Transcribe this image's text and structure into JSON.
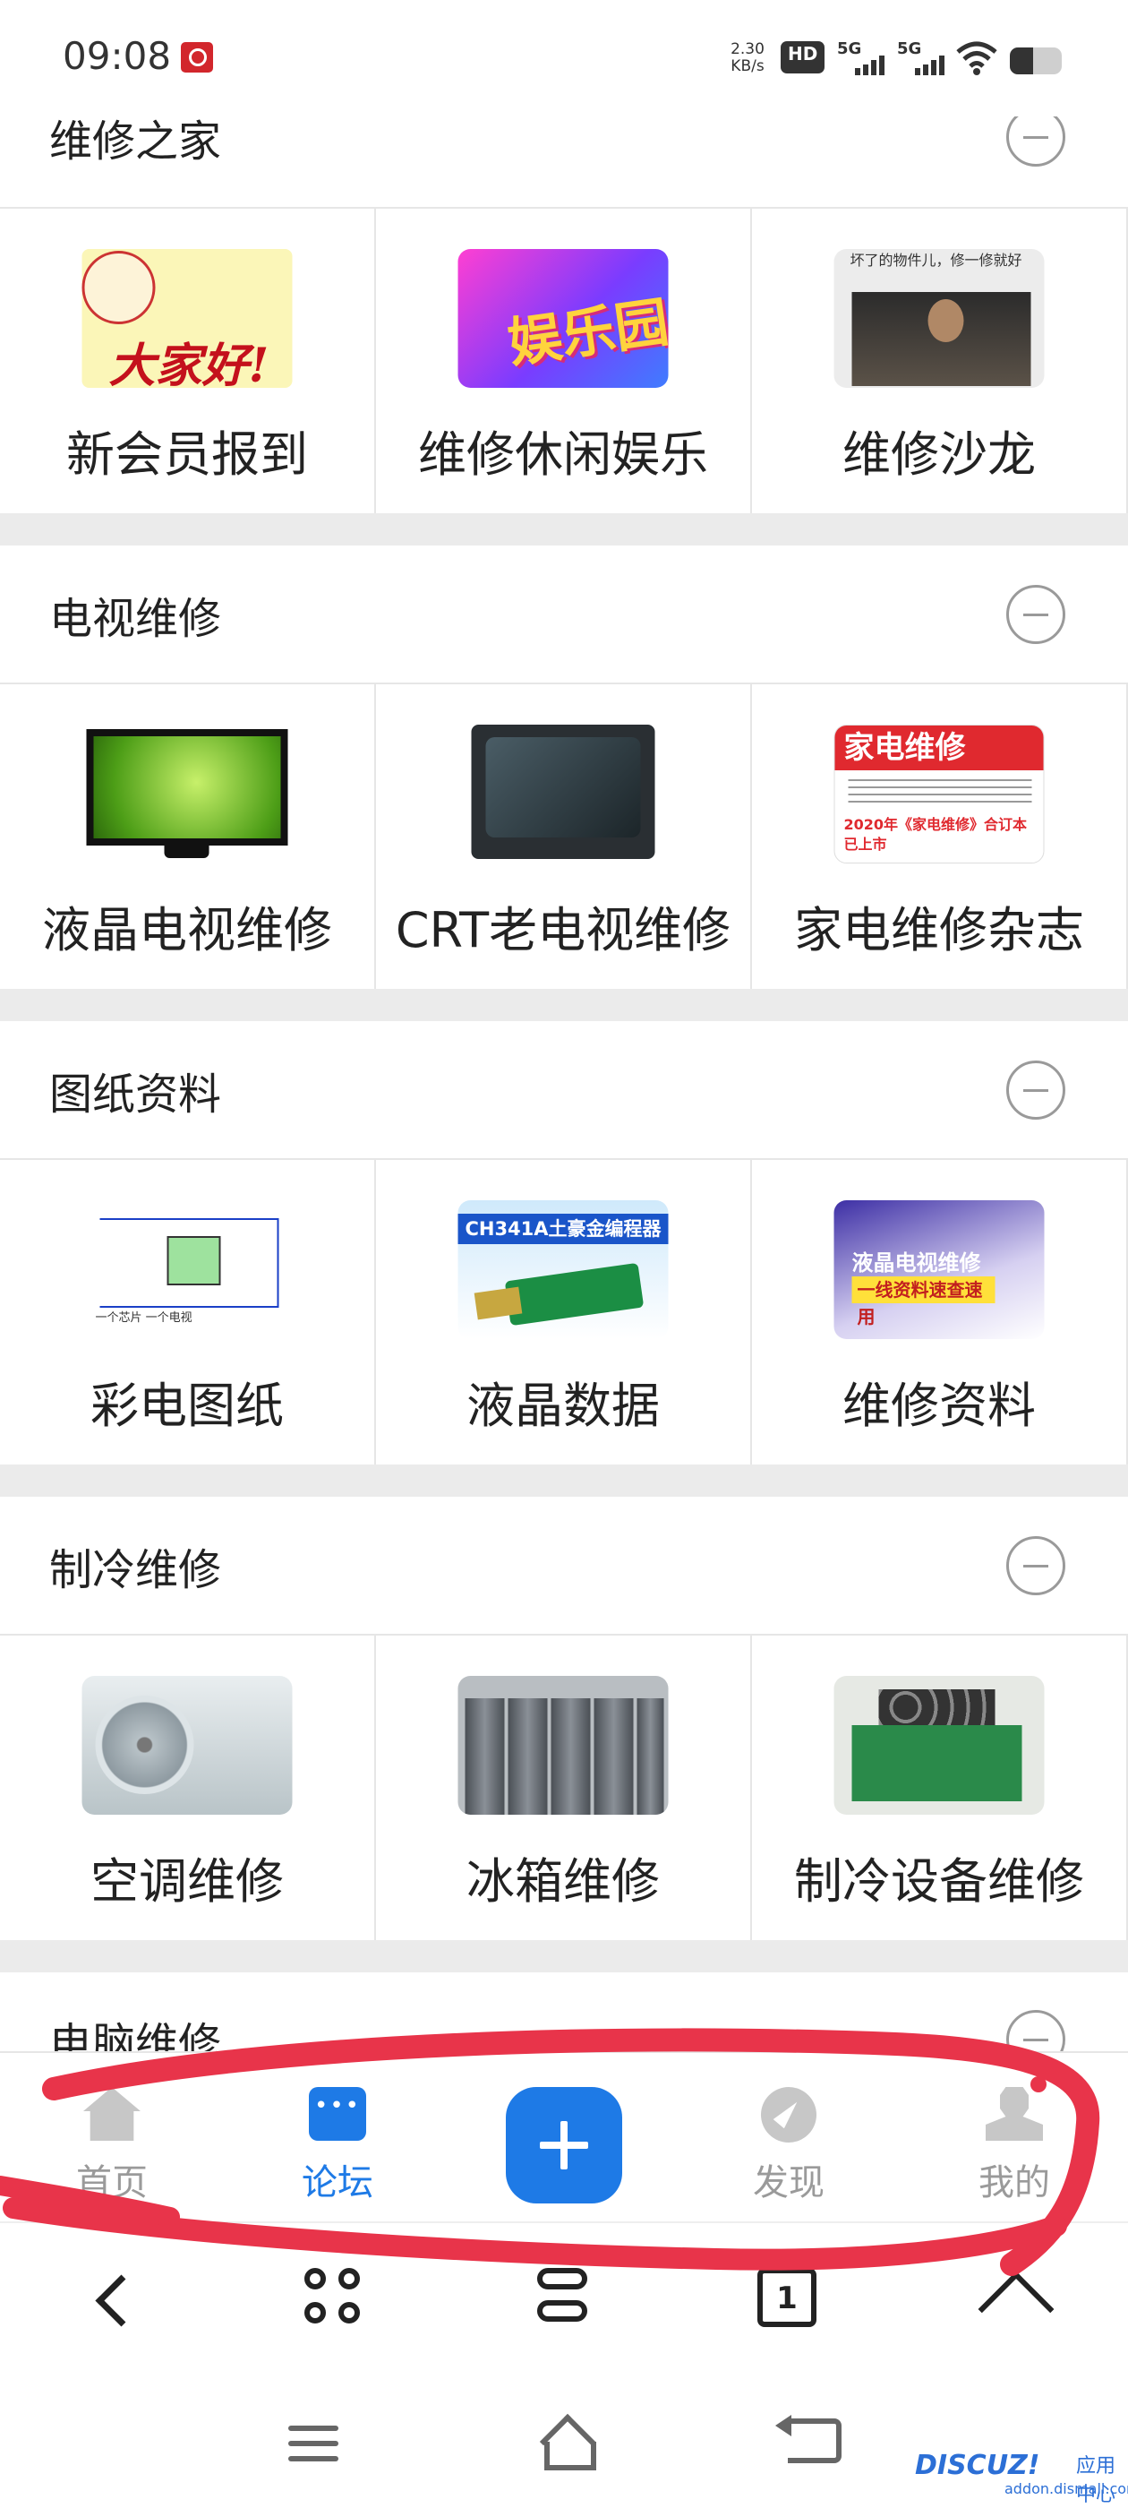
{
  "status_bar": {
    "time": "09:08",
    "net_speed_value": "2.30",
    "net_speed_unit": "KB/s",
    "hd_label": "HD",
    "sim1_label": "5G",
    "sim2_label": "5G"
  },
  "sections": [
    {
      "title": "维修之家",
      "items": [
        {
          "label": "新会员报到",
          "image_text": "大家好!"
        },
        {
          "label": "维修休闲娱乐",
          "image_text": "娱乐园"
        },
        {
          "label": "维修沙龙",
          "image_text": "坏了的物件儿，修一修就好"
        }
      ]
    },
    {
      "title": "电视维修",
      "items": [
        {
          "label": "液晶电视维修"
        },
        {
          "label": "CRT老电视维修"
        },
        {
          "label": "家电维修杂志",
          "image_text": "家电维修",
          "image_subtext": "2020年《家电维修》合订本已上市"
        }
      ]
    },
    {
      "title": "图纸资料",
      "items": [
        {
          "label": "彩电图纸",
          "image_text": "一个芯片 一个电视"
        },
        {
          "label": "液晶数据",
          "image_text": "CH341A土豪金编程器"
        },
        {
          "label": "维修资料",
          "image_text": "液晶电视维修",
          "image_subtext": "一线资料速查速用"
        }
      ]
    },
    {
      "title": "制冷维修",
      "items": [
        {
          "label": "空调维修"
        },
        {
          "label": "冰箱维修"
        },
        {
          "label": "制冷设备维修"
        }
      ]
    }
  ],
  "partial_section_title": "电脑维修",
  "tab_bar": {
    "items": [
      {
        "label": "首页",
        "icon": "home-icon"
      },
      {
        "label": "论坛",
        "icon": "forum-icon",
        "active": true
      },
      {
        "label": "",
        "icon": "plus-icon"
      },
      {
        "label": "发现",
        "icon": "compass-icon"
      },
      {
        "label": "我的",
        "icon": "user-icon"
      }
    ]
  },
  "browser_toolbar": {
    "tab_count": "1"
  },
  "watermark": {
    "logo": "DISCUZ!",
    "sub": "应用中心",
    "url": "addon.dismall.com"
  },
  "colors": {
    "accent": "#1e7ae6",
    "annotation": "#e8344a",
    "divider": "#ebebeb"
  }
}
